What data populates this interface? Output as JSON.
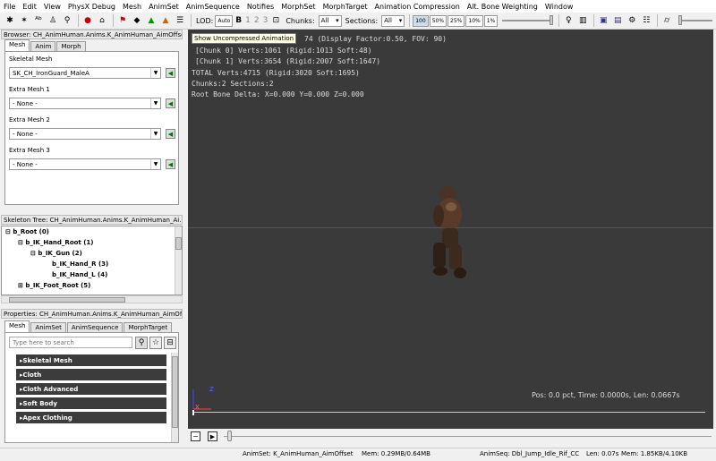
{
  "menu": [
    "File",
    "Edit",
    "View",
    "PhysX Debug",
    "Mesh",
    "AnimSet",
    "AnimSequence",
    "Notifies",
    "MorphSet",
    "MorphTarget",
    "Animation Compression",
    "Alt. Bone Weighting",
    "Window"
  ],
  "toolbar": {
    "lod_label": "LOD:",
    "auto": "Auto",
    "lod_b": "B",
    "lod1": "1",
    "lod2": "2",
    "lod3": "3",
    "chunks_label": "Chunks:",
    "chunks_value": "All",
    "sections_label": "Sections:",
    "sections_value": "All",
    "pcts": [
      "100",
      "50%",
      "25%",
      "10%",
      "1%"
    ]
  },
  "browser": {
    "title": "Browser: CH_AnimHuman.Anims.K_AnimHuman_AimOffset",
    "tabs": [
      "Mesh",
      "Anim",
      "Morph"
    ],
    "skeletal_label": "Skeletal Mesh",
    "skeletal_value": "SK_CH_IronGuard_MaleA",
    "extra": [
      {
        "label": "Extra Mesh 1",
        "value": "- None -"
      },
      {
        "label": "Extra Mesh 2",
        "value": "- None -"
      },
      {
        "label": "Extra Mesh 3",
        "value": "- None -"
      }
    ]
  },
  "skeleton": {
    "title": "Skeleton Tree: CH_AnimHuman.Anims.K_AnimHuman_Ai...",
    "items": [
      "b_Root (0)",
      "b_IK_Hand_Root (1)",
      "b_IK_Gun (2)",
      "b_IK_Hand_R (3)",
      "b_IK_Hand_L (4)",
      "b_IK_Foot_Root (5)"
    ]
  },
  "properties": {
    "title": "Properties: CH_AnimHuman.Anims.K_AnimHuman_AimOf...",
    "tabs": [
      "Mesh",
      "AnimSet",
      "AnimSequence",
      "MorphTarget"
    ],
    "search_placeholder": "Type here to search",
    "sections": [
      "Skeletal Mesh",
      "Cloth",
      "Cloth Advanced",
      "Soft Body",
      "Apex Clothing"
    ]
  },
  "viewport": {
    "tooltip": "Show Uncompressed Animation",
    "line0": "74 (Display Factor:0.50, FOV: 90)",
    "line1": "[Chunk 0] Verts:1061 (Rigid:1013 Soft:48)",
    "line2": "[Chunk 1] Verts:3654 (Rigid:2007 Soft:1647)",
    "line3": "TOTAL Verts:4715 (Rigid:3020 Soft:1695)",
    "line4": "Chunks:2 Sections:2",
    "line5": "Root Bone Delta: X=0.000 Y=0.000 Z=0.000",
    "pos": "Pos: 0.0 pct, Time: 0.0000s, Len: 0.0667s",
    "axis_z": "Z",
    "axis_x": "X"
  },
  "status": {
    "animset": "AnimSet: K_AnimHuman_AimOffset",
    "mem1": "Mem: 0.29MB/0.64MB",
    "animseq": "AnimSeq: Dbl_Jump_Idle_Rif_CC",
    "len": "Len: 0.07s",
    "mem2": "Mem: 1.85KB/4.10KB"
  }
}
